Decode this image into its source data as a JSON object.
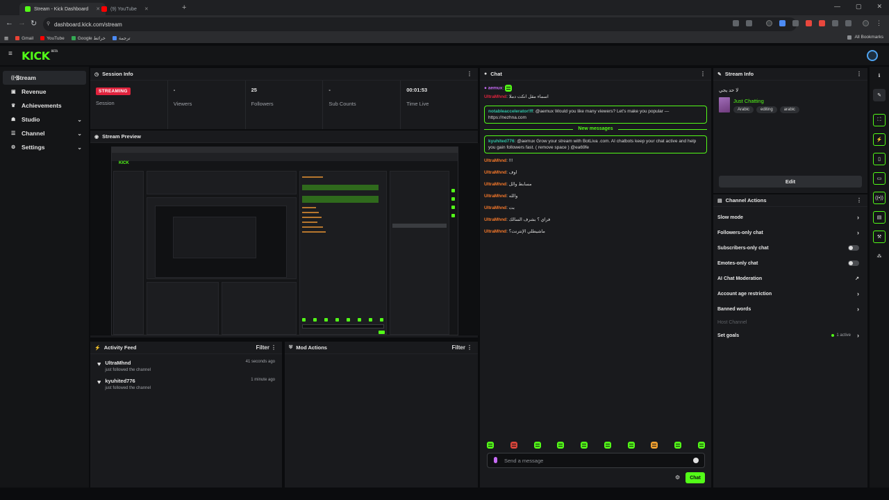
{
  "browser": {
    "tabs": [
      {
        "title": "Stream - Kick Dashboard"
      },
      {
        "title": "(9) YouTube"
      }
    ],
    "url": "dashboard.kick.com/stream",
    "bookmarks": [
      {
        "label": "Gmail",
        "color": "#ea4335"
      },
      {
        "label": "YouTube",
        "color": "#ff0000"
      },
      {
        "label": "Google خرائط",
        "color": "#34a853"
      },
      {
        "label": "ترجمة",
        "color": "#4c8bf5"
      }
    ],
    "all_bookmarks": "All Bookmarks"
  },
  "app": {
    "logo": "KICK",
    "logo_badge": "BETA"
  },
  "sidebar": {
    "items": [
      {
        "label": "Stream",
        "icon": "stream-icon"
      },
      {
        "label": "Revenue",
        "icon": "revenue-icon"
      },
      {
        "label": "Achievements",
        "icon": "trophy-icon"
      },
      {
        "label": "Studio",
        "icon": "studio-icon"
      },
      {
        "label": "Channel",
        "icon": "channel-icon"
      },
      {
        "label": "Settings",
        "icon": "gear-icon"
      }
    ]
  },
  "session_info": {
    "title": "Session Info",
    "status_badge": "STREAMING",
    "stats": [
      {
        "value": "",
        "label": "Session"
      },
      {
        "value": "-",
        "label": "Viewers"
      },
      {
        "value": "25",
        "label": "Followers"
      },
      {
        "value": "-",
        "label": "Sub Counts"
      },
      {
        "value": "00:01:53",
        "label": "Time Live"
      }
    ]
  },
  "stream_preview": {
    "title": "Stream Preview"
  },
  "activity_feed": {
    "title": "Activity Feed",
    "filter_label": "Filter",
    "items": [
      {
        "name": "UltraMhnd",
        "text": "just followed the channel",
        "time": "41 seconds ago"
      },
      {
        "name": "kyuhited776",
        "text": "just followed the channel",
        "time": "1 minute ago"
      }
    ]
  },
  "mod_actions": {
    "title": "Mod Actions",
    "filter_label": "Filter"
  },
  "chat": {
    "title": "Chat",
    "pinned_user": "aemux",
    "messages_top": [
      {
        "user": "UltraMhnd",
        "user_color": "red",
        "text": "اسماء مقل انكت دملا"
      },
      {
        "user": "notableaccelerator!ff",
        "user_color": "teal",
        "text": "@aemux Would you like many viewers? Let's make you popular — https://nezhna.com",
        "boxed": true
      }
    ],
    "new_messages_label": "New messages",
    "messages_bottom": [
      {
        "user": "kyuhited776",
        "user_color": "teal",
        "text": "@aemux Grow your stream with BotLiva .com. AI chatbots keep your chat active and help you gain followers fast. ( remove space ) @ea69fe",
        "boxed": true
      },
      {
        "user": "UltraMhnd",
        "user_color": "orange",
        "text": "!!!"
      },
      {
        "user": "UltraMhnd",
        "user_color": "orange",
        "text": "اوف"
      },
      {
        "user": "UltraMhnd",
        "user_color": "orange",
        "text": "مسابط والل"
      },
      {
        "user": "UltraMhnd",
        "user_color": "orange",
        "text": "والله"
      },
      {
        "user": "UltraMhnd",
        "user_color": "orange",
        "text": "بت"
      },
      {
        "user": "UltraMhnd",
        "user_color": "orange",
        "text": "فراي ؟ بشرف السالك"
      },
      {
        "user": "UltraMhnd",
        "user_color": "orange",
        "text": "ماشيطلي الإنترنت؟"
      }
    ],
    "input_placeholder": "Send a message",
    "send_label": "Chat"
  },
  "stream_info": {
    "title": "Stream Info",
    "stream_title": "لا حد يجي",
    "category": "Just Chatting",
    "tags": [
      "Arabic",
      "editing",
      "arabic"
    ],
    "edit_label": "Edit"
  },
  "channel_actions": {
    "title": "Channel Actions",
    "rows": [
      {
        "label": "Slow mode",
        "control": "chevron"
      },
      {
        "label": "Followers-only chat",
        "control": "chevron"
      },
      {
        "label": "Subscribers-only chat",
        "control": "toggle"
      },
      {
        "label": "Emotes-only chat",
        "control": "toggle"
      },
      {
        "label": "AI Chat Moderation",
        "control": "external"
      },
      {
        "label": "Account age restriction",
        "control": "chevron"
      },
      {
        "label": "Banned words",
        "control": "chevron"
      },
      {
        "label": "Host Channel",
        "control": "none"
      },
      {
        "label": "Set goals",
        "control": "chevron"
      }
    ],
    "goals_status": "1 active"
  },
  "colors": {
    "brand_green": "#53fc18",
    "live_red": "#e0233d",
    "panel_bg": "#191a1d"
  }
}
